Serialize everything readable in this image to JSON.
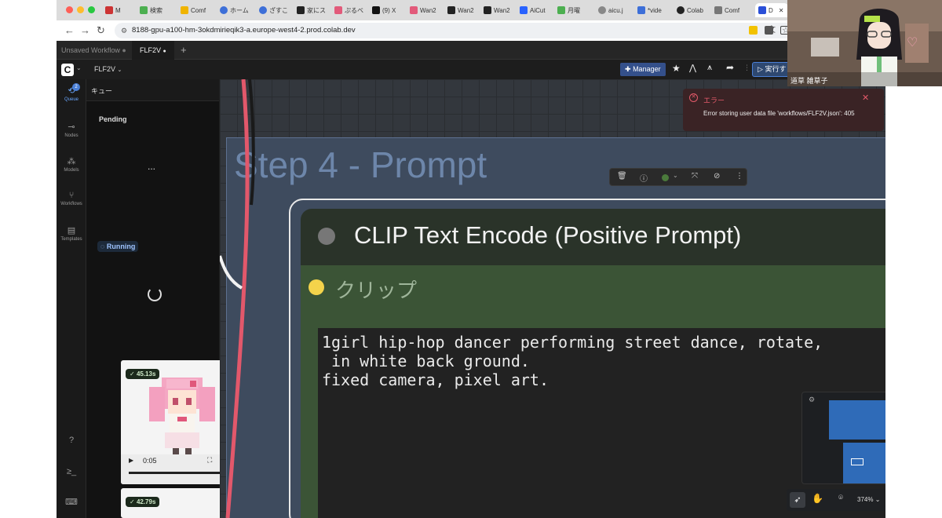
{
  "browser": {
    "tabs": [
      "M",
      "検索",
      "Comf",
      "ホーム",
      "ざすこ",
      "家にス",
      "ぷるべ",
      "(9) X",
      "Wan2",
      "Wan2",
      "Wan2",
      "AiCut",
      "月曜",
      "aicu.j",
      "*vide",
      "Colab",
      "Comf",
      "D"
    ],
    "url": "8188-gpu-a100-hm-3okdmirieqik3-a.europe-west4-2.prod.colab.dev"
  },
  "workflow_tabs": {
    "tab1": "Unsaved Workflow",
    "tab2": "FLF2V",
    "add": "+"
  },
  "topbar": {
    "menu": "FLF2V",
    "manager": "Manager",
    "run": "実行す"
  },
  "sidebar": {
    "queue": "Queue",
    "queue_badge": "2",
    "nodes": "Nodes",
    "models": "Models",
    "workflows": "Workflows",
    "templates": "Templates"
  },
  "queue": {
    "title": "キュー",
    "pending": "Pending",
    "dots": "...",
    "running": "Running",
    "job1_time": "45.13s",
    "job1_video_time": "0:05",
    "job2_time": "42.79s"
  },
  "error": {
    "title": "エラー",
    "message": "Error storing user data file 'workflows/FLF2V.json': 405"
  },
  "canvas": {
    "group_title": "Step 4 - Prompt",
    "node_title": "CLIP Text Encode (Positive Prompt)",
    "input_label": "クリップ",
    "prompt_lines": [
      "1girl hip-hop dancer performing street dance, rotate,",
      " in white back ground.",
      "fixed camera, pixel art."
    ]
  },
  "bottom_toolbar": {
    "zoom": "374%"
  },
  "webcam": {
    "name": "道草 雑草子"
  },
  "colors": {
    "node_title_bg": "#2a3329",
    "node_body": "#3b5436",
    "group_bg": "#3f4d60",
    "error_bg": "#3a2325",
    "accent_blue": "#4a7fd6",
    "link_red": "#e2586b"
  }
}
